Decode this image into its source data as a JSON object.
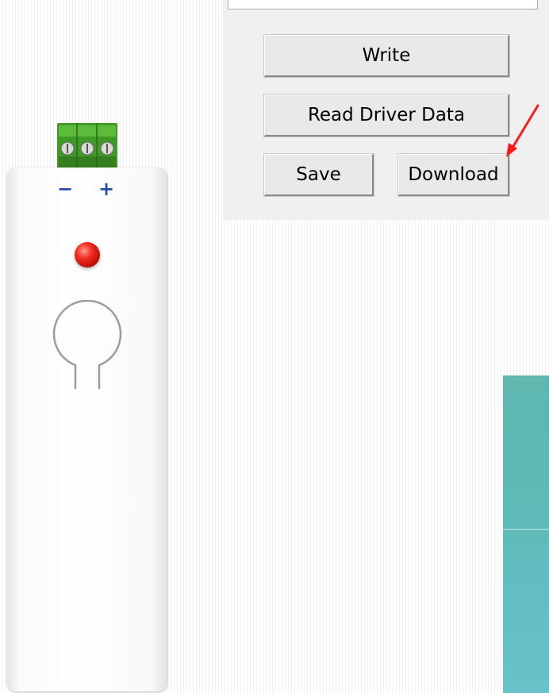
{
  "panel": {
    "buttons": {
      "write": "Write",
      "read_driver_data": "Read Driver Data",
      "save": "Save",
      "download": "Download"
    }
  },
  "device": {
    "polarity_minus": "−",
    "polarity_plus": "+",
    "terminal_screws": [
      "⊕",
      "⊕",
      "⊕"
    ]
  },
  "colors": {
    "annotation_arrow": "#ff1a1a",
    "terminal_block": "#4cae2e",
    "led": "#e8190f",
    "polarity": "#2a4fa8",
    "teal_image": "#5fb7b0"
  },
  "icons": {
    "annotation": "arrow-icon",
    "terminal": "terminal-block-icon",
    "led": "led-icon",
    "keyhole": "keyhole-icon"
  }
}
